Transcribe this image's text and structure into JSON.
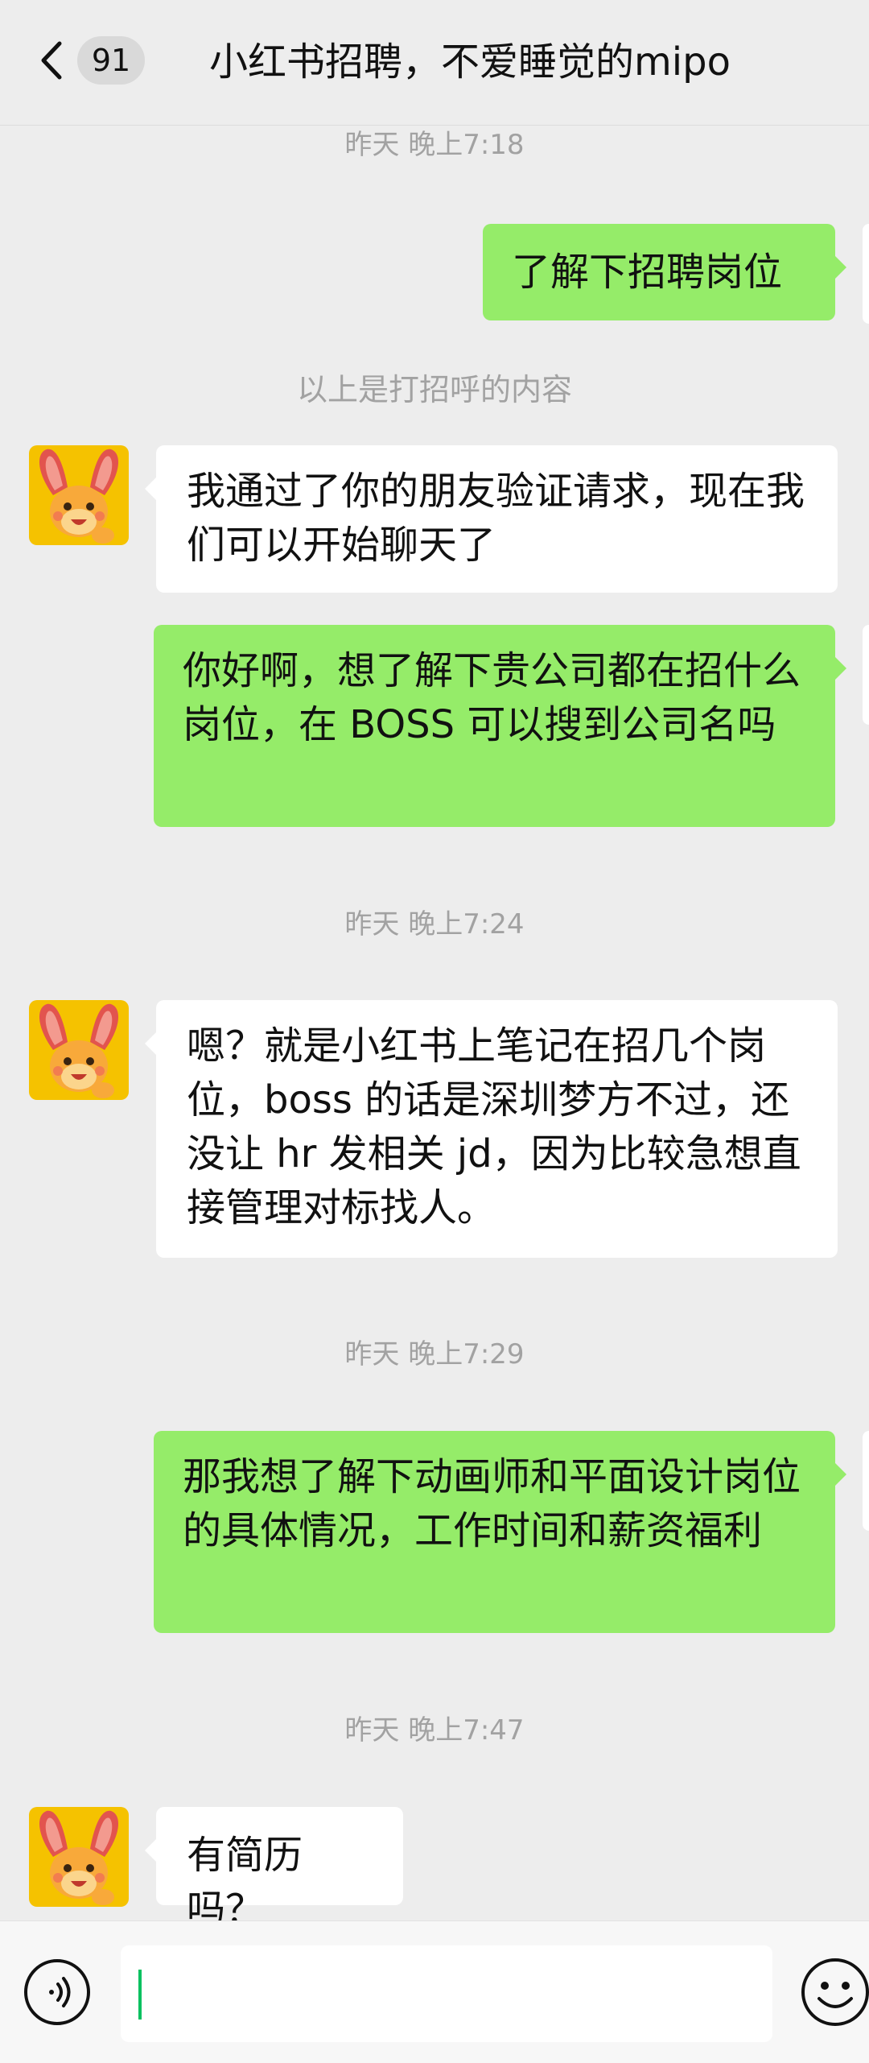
{
  "header": {
    "back_badge": "91",
    "title": "小红书招聘，不爱睡觉的mipo"
  },
  "chat": {
    "time1": "昨天 晚上7:18",
    "msg1": "了解下招聘岗位",
    "system_note": "以上是打招呼的内容",
    "msg2": "我通过了你的朋友验证请求，现在我们可以开始聊天了",
    "msg3": "你好啊，想了解下贵公司都在招什么岗位，在 BOSS 可以搜到公司名吗",
    "time2": "昨天 晚上7:24",
    "msg4": "嗯？就是小红书上笔记在招几个岗位，boss 的话是深圳梦方不过，还没让 hr 发相关 jd，因为比较急想直接管理对标找人。",
    "time3": "昨天 晚上7:29",
    "msg5": "那我想了解下动画师和平面设计岗位的具体情况，工作时间和薪资福利",
    "time4": "昨天 晚上7:47",
    "msg6": "有简历吗？"
  },
  "input": {
    "value": ""
  },
  "colors": {
    "background": "#EDEDED",
    "outgoing_bubble": "#95EC69",
    "incoming_bubble": "#FFFFFF",
    "caret": "#07C160"
  },
  "icons": {
    "back": "chevron-left-icon",
    "voice": "voice-icon",
    "emoji": "emoji-icon",
    "avatar": "rabbit-mascot-avatar"
  }
}
